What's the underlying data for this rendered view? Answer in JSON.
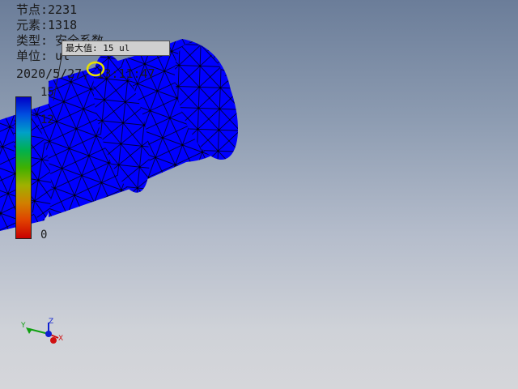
{
  "result_info": {
    "nodes": "节点:2231",
    "elements": "元素:1318",
    "type": "类型: 安全系数",
    "unit": "单位: ul",
    "timestamp": "2020/5/27, 13:11:47"
  },
  "legend": {
    "max_label": "15",
    "mid_label": "12",
    "min_label": "0",
    "colors": [
      "#0000c8",
      "#0050e0",
      "#00a0c8",
      "#00b050",
      "#40b000",
      "#a0b000",
      "#d08000",
      "#e04000",
      "#c80000"
    ]
  },
  "probe": {
    "label": "最大值: 15 ul"
  },
  "triad": {
    "x_label": "X",
    "y_label": "Y",
    "z_label": "Z",
    "x_color": "#d01010",
    "y_color": "#10a010",
    "z_color": "#1020d0"
  },
  "model": {
    "fill_color": "#0000ff",
    "mesh_color": "#000000",
    "probe_marker_color": "#e8e000"
  }
}
